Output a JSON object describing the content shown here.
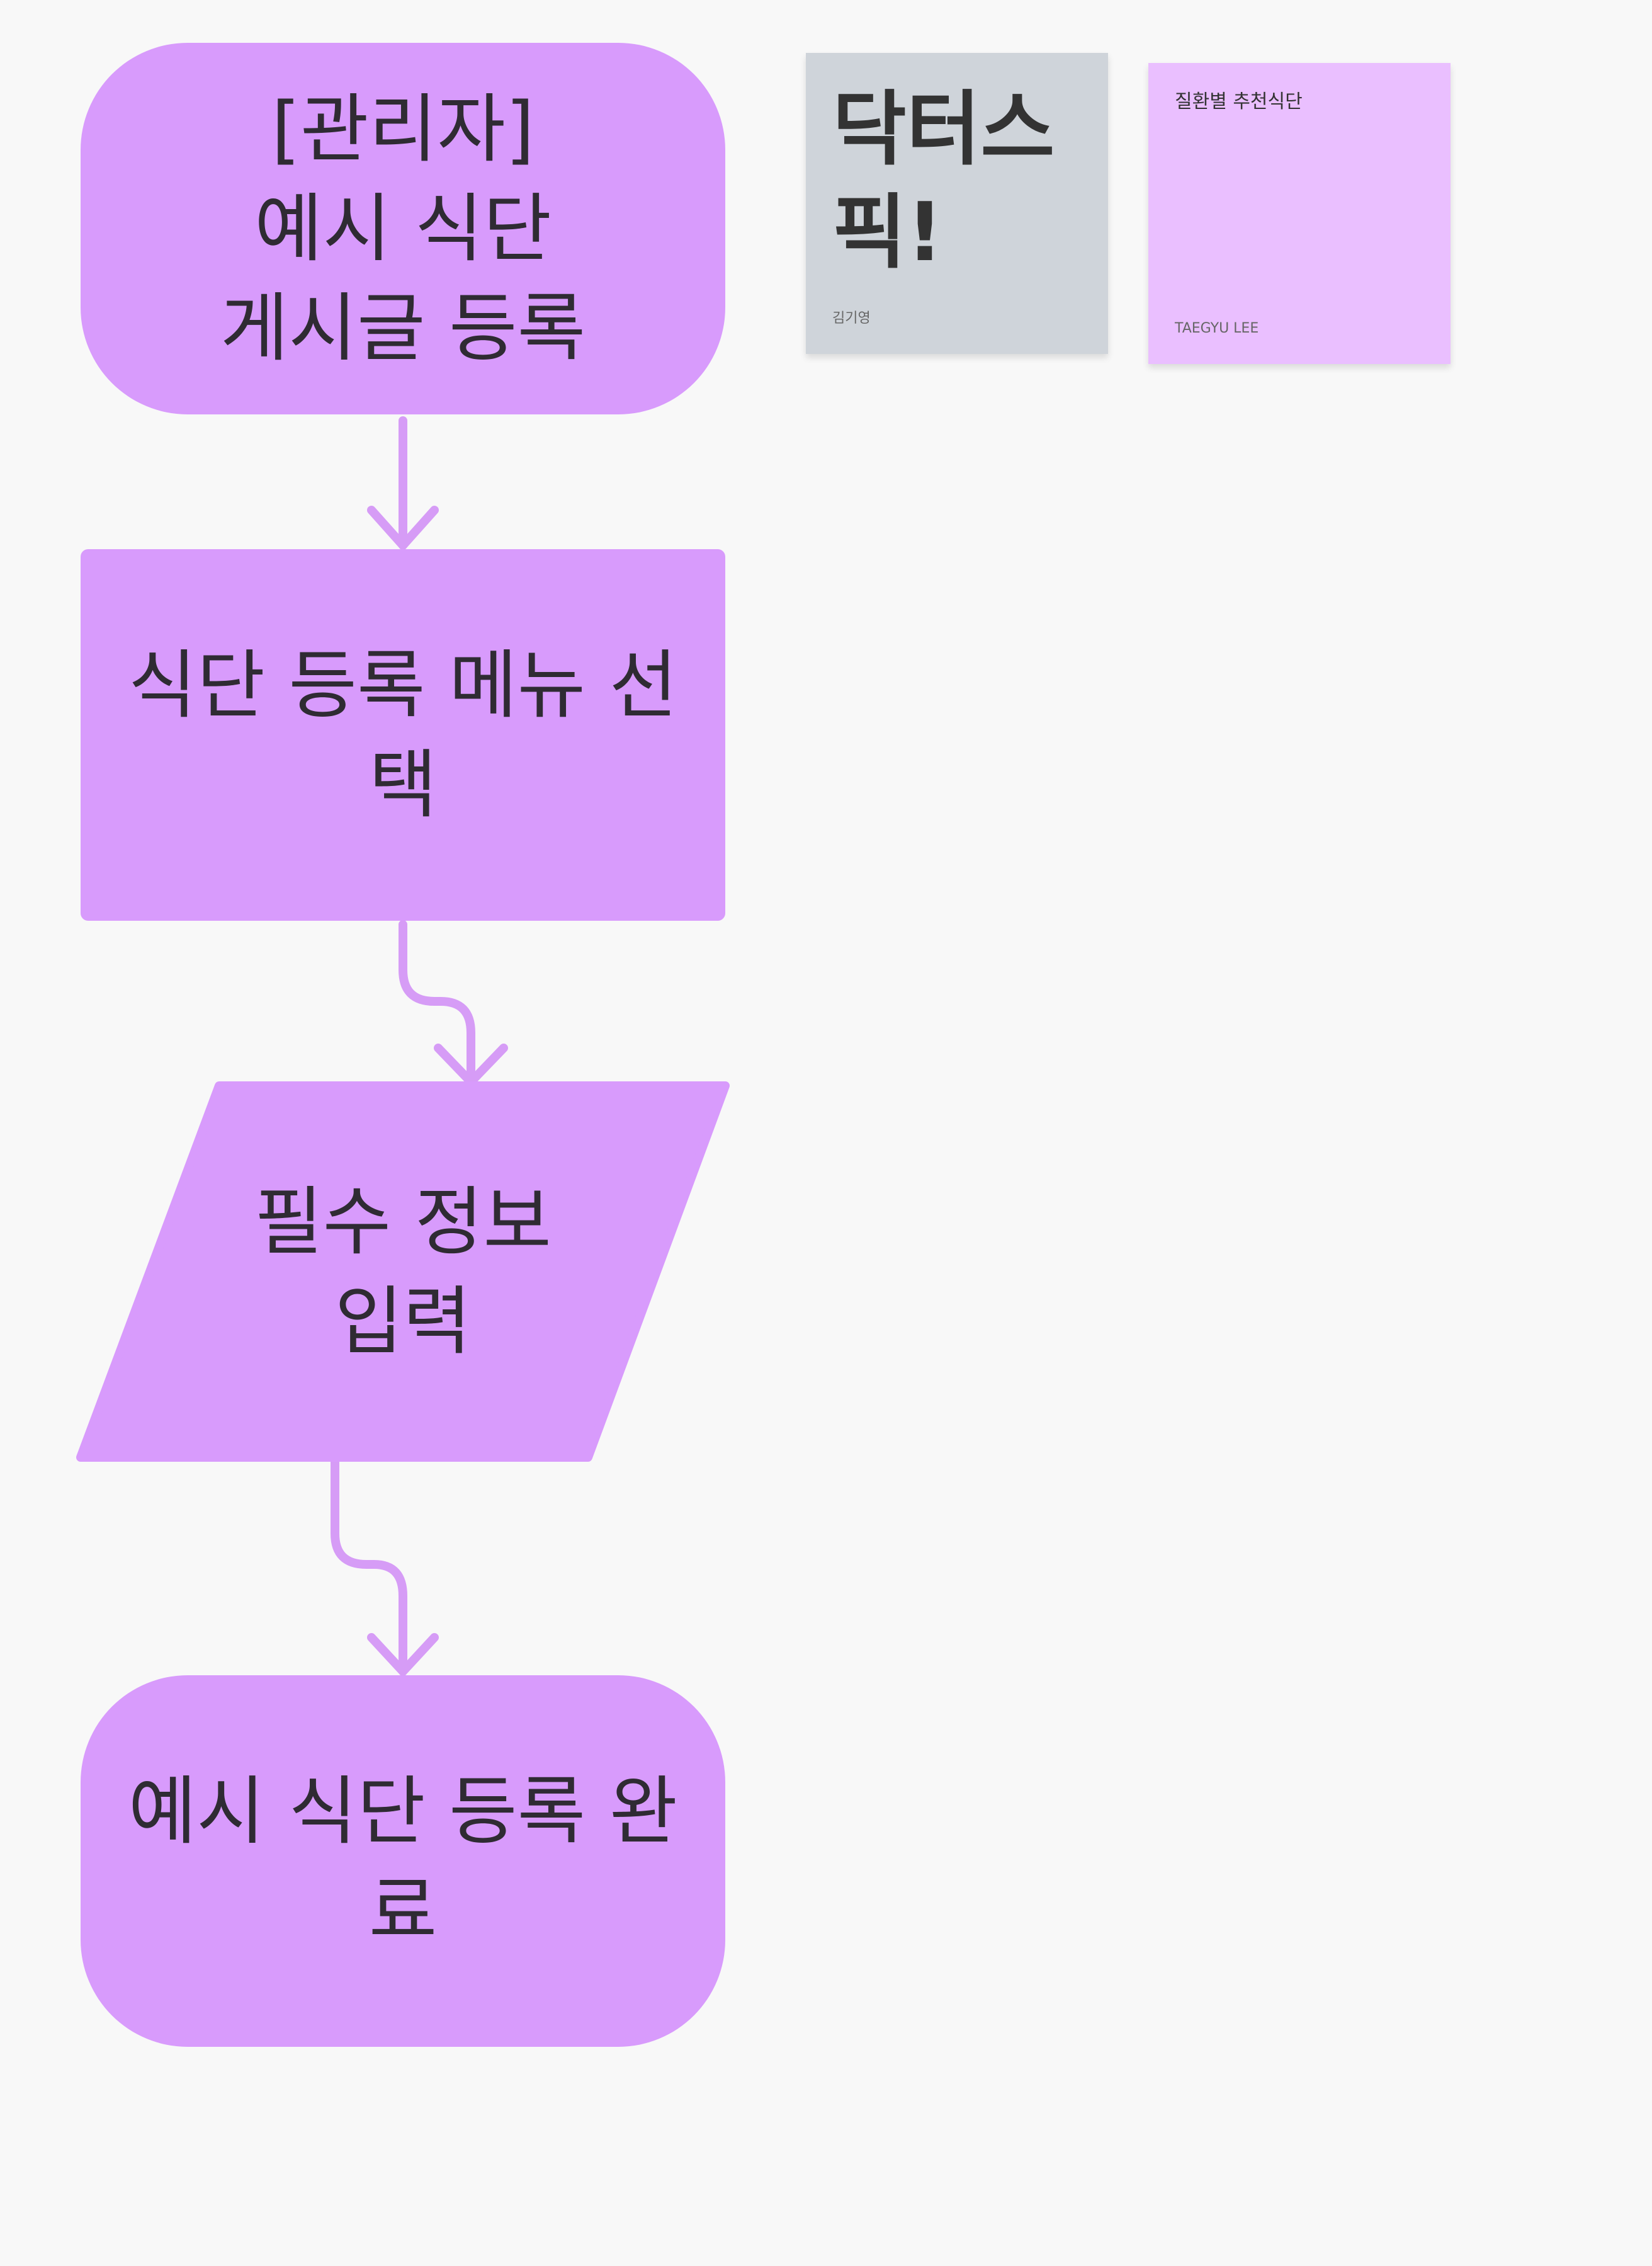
{
  "flowchart": {
    "start": "[관리자]\n예시 식단\n게시글 등록",
    "step_menu": "식단 등록 메뉴 선\n택",
    "step_input": "필수 정보\n입력",
    "end": "예시 식단 등록 완\n료"
  },
  "sticky_notes": [
    {
      "text": "닥터스\n픽!",
      "author": "김기영"
    },
    {
      "text": "질환별 추천식단",
      "author": "TAEGYU LEE"
    }
  ],
  "colors": {
    "shape_fill": "#d89bfc",
    "connector": "#d69cf6",
    "sticky_gray": "#cfd4da",
    "sticky_purple": "#eabfff",
    "background": "#f8f8f8"
  }
}
